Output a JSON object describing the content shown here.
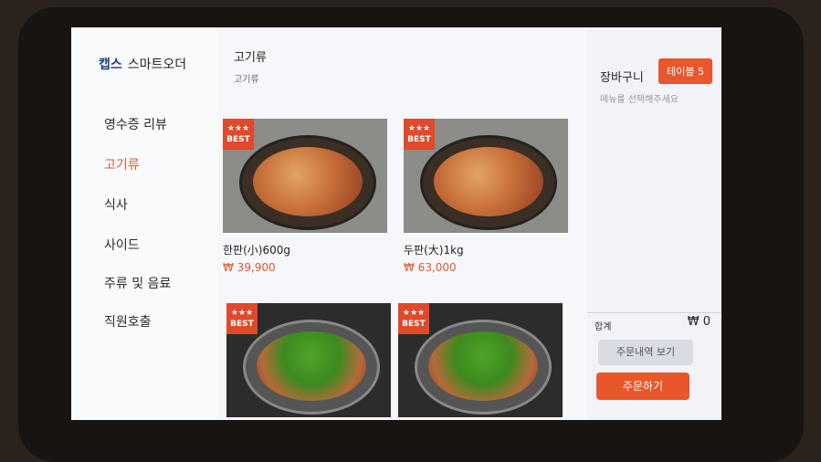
{
  "brand": {
    "name": "캡스",
    "subtitle": "스마트오더"
  },
  "nav": {
    "items": [
      {
        "label": "영수증 리뷰"
      },
      {
        "label": "고기류"
      },
      {
        "label": "식사"
      },
      {
        "label": "사이드"
      },
      {
        "label": "주류 및 음료"
      },
      {
        "label": "직원호출"
      }
    ],
    "active_index": 1
  },
  "main": {
    "category_title": "고기류",
    "category_subtitle": "고기류"
  },
  "menu": {
    "items": [
      {
        "badge_stars": "★★★",
        "badge": "BEST",
        "name": "한판(小)600g",
        "price": "₩ 39,900"
      },
      {
        "badge_stars": "★★★",
        "badge": "BEST",
        "name": "두판(大)1kg",
        "price": "₩ 63,000"
      },
      {
        "badge_stars": "★★★",
        "badge": "BEST",
        "name": "",
        "price": ""
      },
      {
        "badge_stars": "★★★",
        "badge": "BEST",
        "name": "",
        "price": ""
      }
    ]
  },
  "cart": {
    "title": "장바구니",
    "table": "테이블 5",
    "empty_message": "메뉴를 선택해주세요",
    "total_label": "합계",
    "total_value": "₩ 0",
    "history_button": "주문내역 보기",
    "order_button": "주문하기"
  },
  "colors": {
    "accent": "#e8562b",
    "brand": "#1f3c93",
    "active_nav": "#e05a2b"
  }
}
